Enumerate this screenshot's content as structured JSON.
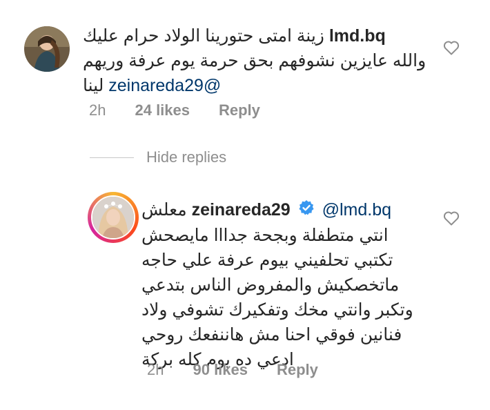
{
  "comment1": {
    "username": "lmd.bq",
    "line1": "زينة امتى حتورينا الولاد حرام عليك",
    "line2": "والله عايزين نشوفهم بحق حرمة يوم عرفة وريهم",
    "line3_text": "لينا",
    "mention": "@zeinareda29",
    "time": "2h",
    "likes": "24 likes",
    "reply_label": "Reply"
  },
  "hide_replies_label": "Hide replies",
  "reply1": {
    "username": "zeinareda29",
    "mention": "@lmd.bq",
    "lines": [
      "معلش",
      "انتي متطفلة وبجحة جدااا مايصحش",
      "تكتبي تحلفيني بيوم عرفة علي حاجه",
      "ماتخصكيش والمفروض الناس بتدعي",
      "وتكبر وانتي مخك وتفكيرك تشوفي ولاد",
      "فنانين فوقي احنا مش هاننفعك روحي",
      "ادعي ده يوم كله بركة"
    ],
    "time": "2h",
    "likes": "90 likes",
    "reply_label": "Reply"
  },
  "colors": {
    "text": "#262626",
    "muted": "#8e8e8e",
    "mention": "#00376b",
    "verified": "#3897f0"
  },
  "icons": [
    "heart-icon",
    "verified-badge-icon"
  ]
}
